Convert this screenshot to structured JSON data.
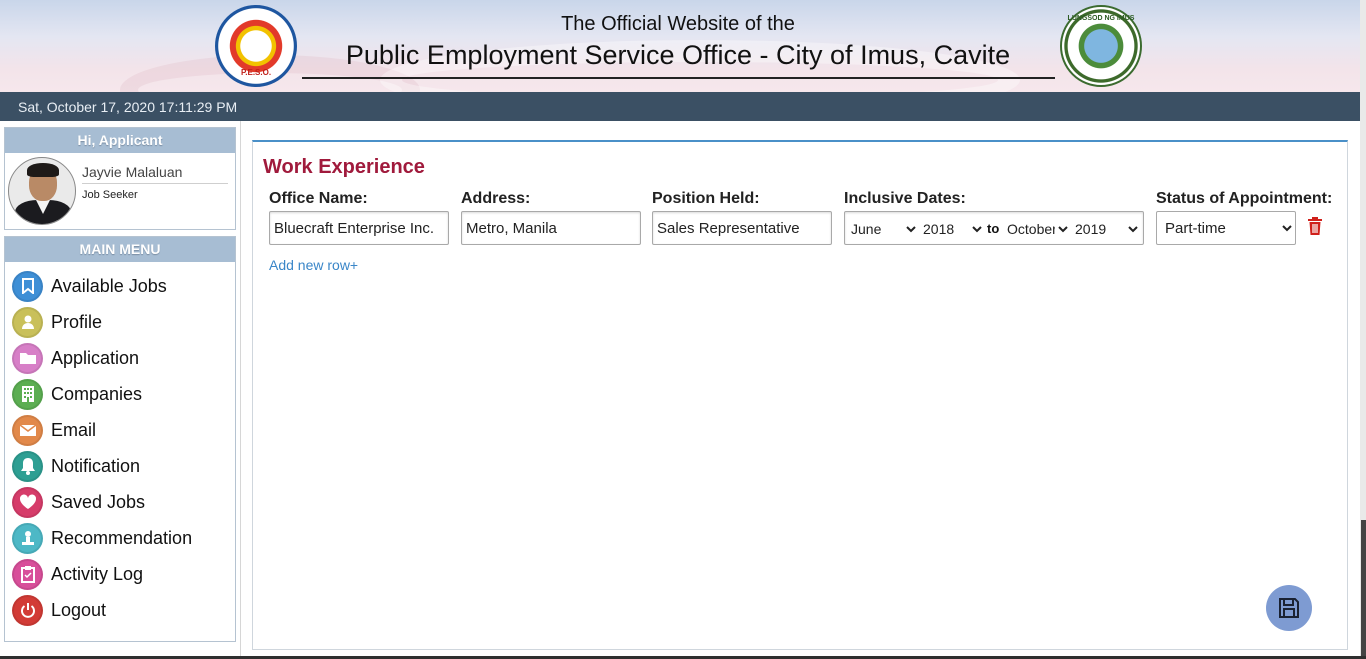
{
  "header": {
    "subtitle": "The Official Website of the",
    "title": "Public Employment Service Office - City of Imus, Cavite",
    "logo_left_text": "P.E.S.O.",
    "logo_right_text": "LUNGSOD NG IMUS"
  },
  "datebar": {
    "datetime": "Sat, October 17, 2020 17:11:29 PM"
  },
  "sidebar": {
    "greeting": "Hi, Applicant",
    "user_name": "Jayvie Malaluan",
    "user_role": "Job Seeker",
    "menu_title": "MAIN MENU",
    "items": [
      {
        "label": "Available Jobs",
        "icon": "bookmark-icon",
        "color": "#3e8fd6"
      },
      {
        "label": "Profile",
        "icon": "user-icon",
        "color": "#c9c05a"
      },
      {
        "label": "Application",
        "icon": "folder-icon",
        "color": "#d77fc7"
      },
      {
        "label": "Companies",
        "icon": "building-icon",
        "color": "#5cae52"
      },
      {
        "label": "Email",
        "icon": "envelope-icon",
        "color": "#e2894a"
      },
      {
        "label": "Notification",
        "icon": "bell-icon",
        "color": "#2e9f93"
      },
      {
        "label": "Saved Jobs",
        "icon": "heart-icon",
        "color": "#d63c6a"
      },
      {
        "label": "Recommendation",
        "icon": "award-icon",
        "color": "#4db8c6"
      },
      {
        "label": "Activity Log",
        "icon": "clipboard-icon",
        "color": "#d84f9a"
      },
      {
        "label": "Logout",
        "icon": "power-icon",
        "color": "#d23b36"
      }
    ]
  },
  "work_experience": {
    "title": "Work Experience",
    "labels": {
      "office": "Office Name:",
      "address": "Address:",
      "position": "Position Held:",
      "dates": "Inclusive Dates:",
      "status": "Status of Appointment:"
    },
    "row": {
      "office": "Bluecraft Enterprise Inc.",
      "address": "Metro, Manila",
      "position": "Sales Representative",
      "from_month": "June",
      "from_year": "2018",
      "to_label": "to",
      "to_month": "October",
      "to_year": "2019",
      "status": "Part-time"
    },
    "add_row": "Add new row+"
  },
  "colors": {
    "datebar": "#3b5064",
    "panel_head": "#a7bdd3",
    "section_title": "#a01a3c",
    "link": "#3a86c8",
    "save_button": "#7e9bd2"
  }
}
